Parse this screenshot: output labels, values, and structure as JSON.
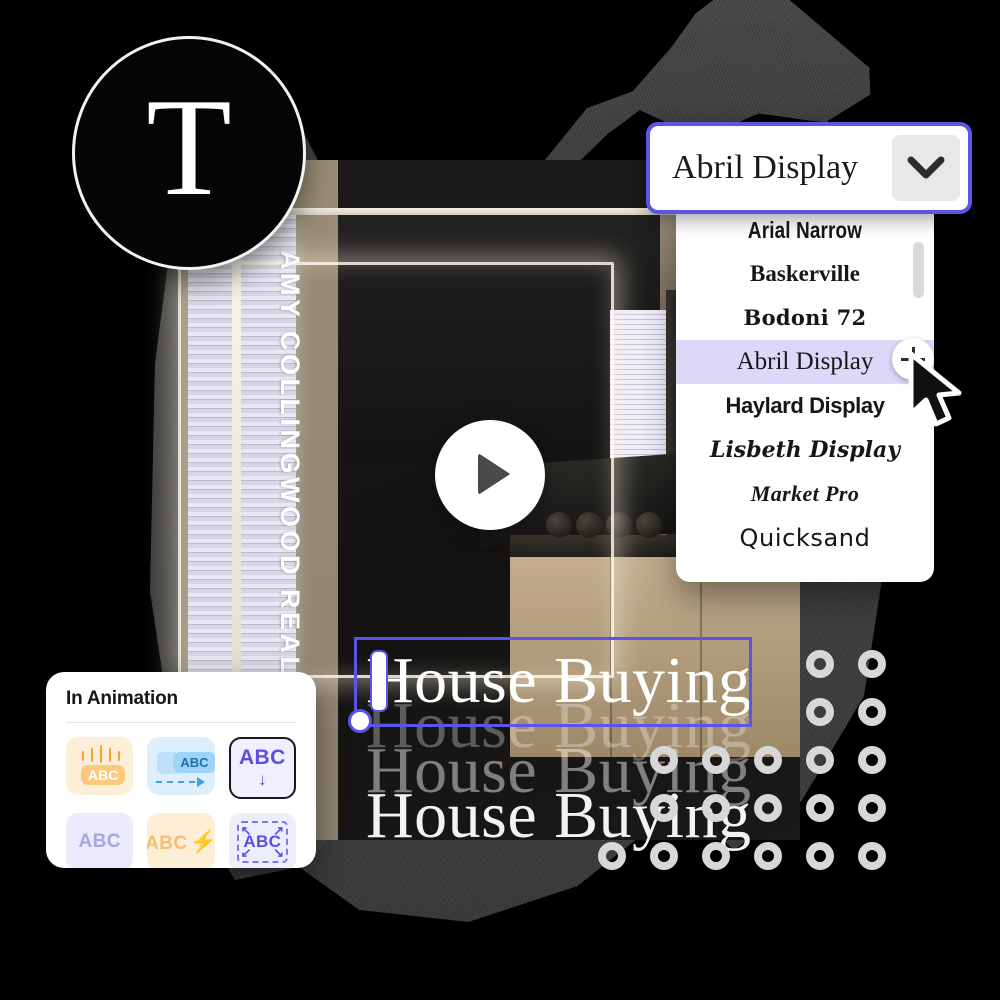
{
  "text_tool": {
    "glyph": "T",
    "name": "text-tool"
  },
  "font_select": {
    "value": "Abril Display",
    "caret_icon": "chevron-down-icon"
  },
  "font_menu": {
    "items": [
      {
        "label": "Arial Narrow",
        "style": "f-arial",
        "selected": false
      },
      {
        "label": "Baskerville",
        "style": "f-bask",
        "selected": false
      },
      {
        "label": "Bodoni 72",
        "style": "f-bodoni",
        "selected": false
      },
      {
        "label": "Abril Display",
        "style": "f-abril",
        "selected": true
      },
      {
        "label": "Haylard Display",
        "style": "f-haylard",
        "selected": false
      },
      {
        "label": "Lisbeth Display",
        "style": "f-lisbeth",
        "selected": false
      },
      {
        "label": "Market Pro",
        "style": "f-market",
        "selected": false
      },
      {
        "label": "Quicksand",
        "style": "f-quick",
        "selected": false
      }
    ]
  },
  "canvas": {
    "brand_vertical_text": "AMY COLLINGWOOD REALT",
    "play_button": "play-icon",
    "headline": "House Buying",
    "echo_count": 4,
    "selection_accent": "#5b54e8"
  },
  "animation_panel": {
    "title": "In Animation",
    "options": [
      {
        "label": "ABC",
        "name": "anim-drop",
        "class": "c1",
        "selected": false
      },
      {
        "label": "ABC",
        "name": "anim-slide",
        "class": "c2",
        "selected": false
      },
      {
        "label": "ABC",
        "name": "anim-descend",
        "class": "c3",
        "selected": true,
        "sub": "↓"
      },
      {
        "label": "ABC",
        "name": "anim-fade",
        "class": "c4",
        "selected": false
      },
      {
        "label": "ABC",
        "name": "anim-flash",
        "class": "c5",
        "selected": false,
        "sub": "⚡"
      },
      {
        "label": "ABC",
        "name": "anim-scale",
        "class": "c6",
        "selected": false
      }
    ]
  },
  "cursor": {
    "name": "mouse-pointer",
    "click_indicator": "click-ripple"
  },
  "colors": {
    "accent_purple": "#5b54e8",
    "selected_row": "#dcd8f7",
    "brand_beige": "#9a8e77",
    "canvas_black": "#000000"
  }
}
